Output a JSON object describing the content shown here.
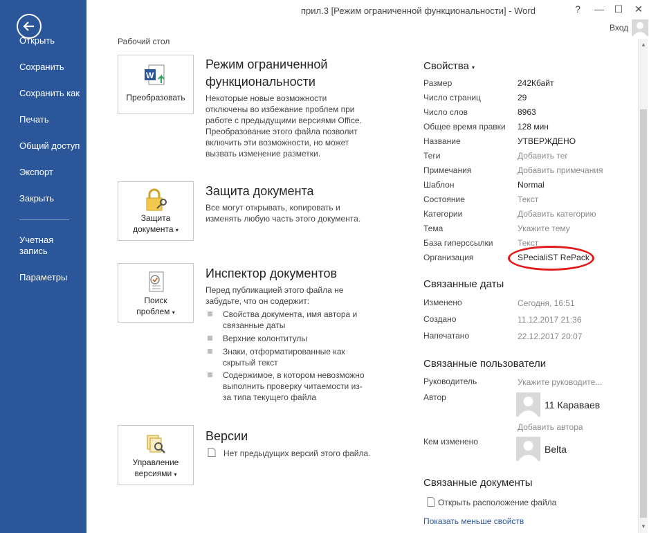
{
  "window": {
    "title": "прил.3 [Режим ограниченной функциональности] - Word",
    "login": "Вход",
    "help": "?",
    "minimize": "—",
    "maximize": "☐",
    "close": "✕"
  },
  "sidebar": {
    "items": [
      {
        "label": "Открыть"
      },
      {
        "label": "Сохранить"
      },
      {
        "label": "Сохранить как"
      },
      {
        "label": "Печать"
      },
      {
        "label": "Общий доступ"
      },
      {
        "label": "Экспорт"
      },
      {
        "label": "Закрыть"
      },
      {
        "label": "Учетная запись"
      },
      {
        "label": "Параметры"
      }
    ]
  },
  "location": "Рабочий стол",
  "sections": {
    "compat": {
      "card_label": "Преобразовать",
      "title_line1": "Режим ограниченной",
      "title_line2": "функциональности",
      "desc": [
        "Некоторые новые возможности",
        "отключены во избежание проблем при",
        "работе с предыдущими версиями Office.",
        "Преобразование этого файла позволит",
        "включить эти возможности, но может",
        "вызвать изменение разметки."
      ]
    },
    "protect": {
      "card_label1": "Защита",
      "card_label2": "документа",
      "title": "Защита документа",
      "desc": [
        "Все могут открывать, копировать и",
        "изменять любую часть этого документа."
      ]
    },
    "inspect": {
      "card_label1": "Поиск",
      "card_label2": "проблем",
      "title": "Инспектор документов",
      "desc": [
        "Перед публикацией этого файла не",
        "забудьте, что он содержит:"
      ],
      "bullets": [
        {
          "line1": "Свойства документа, имя автора и",
          "line2": "связанные даты"
        },
        {
          "line1": "Верхние колонтитулы",
          "line2": ""
        },
        {
          "line1": "Знаки, отформатированные как",
          "line2": "скрытый текст"
        },
        {
          "line1": "Содержимое, в котором невозможно",
          "line2": "выполнить проверку читаемости из-",
          "line3": "за типа текущего файла"
        }
      ]
    },
    "versions": {
      "card_label1": "Управление",
      "card_label2": "версиями",
      "title": "Версии",
      "desc": "Нет предыдущих версий этого файла."
    }
  },
  "properties": {
    "heading": "Свойства",
    "rows": [
      {
        "label": "Размер",
        "value": "242Кбайт"
      },
      {
        "label": "Число страниц",
        "value": "29"
      },
      {
        "label": "Число слов",
        "value": "8963"
      },
      {
        "label": "Общее время правки",
        "value": "128 мин"
      },
      {
        "label": "Название",
        "value": "УТВЕРЖДЕНО"
      },
      {
        "label": "Теги",
        "value": "Добавить тег"
      },
      {
        "label": "Примечания",
        "value": "Добавить примечания"
      },
      {
        "label": "Шаблон",
        "value": "Normal"
      },
      {
        "label": "Состояние",
        "value": "Текст"
      },
      {
        "label": "Категории",
        "value": "Добавить категорию"
      },
      {
        "label": "Тема",
        "value": "Укажите тему"
      },
      {
        "label": "База гиперссылки",
        "value": "Текст"
      },
      {
        "label": "Организация",
        "value": "SPecialiST RePack"
      }
    ]
  },
  "dates": {
    "heading": "Связанные даты",
    "rows": [
      {
        "label": "Изменено",
        "value": "Сегодня, 16:51"
      },
      {
        "label": "Создано",
        "value": "11.12.2017 21:36"
      },
      {
        "label": "Напечатано",
        "value": "22.12.2017 20:07"
      }
    ]
  },
  "people": {
    "heading": "Связанные пользователи",
    "manager_label": "Руководитель",
    "manager_value": "Укажите руководите...",
    "author_label": "Автор",
    "author_name": "11 Караваев",
    "add_author": "Добавить автора",
    "modified_label": "Кем изменено",
    "modified_name": "Belta"
  },
  "docs": {
    "heading": "Связанные документы",
    "open_location": "Открыть расположение файла",
    "show_less": "Показать меньше свойств"
  },
  "colors": {
    "sidebar": "#2b579a",
    "accent": "#2b579a",
    "annotation": "#e31b1b"
  }
}
